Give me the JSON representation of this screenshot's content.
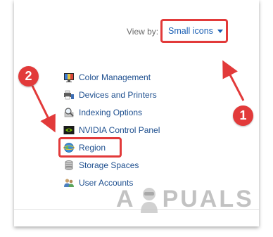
{
  "toolbar": {
    "view_by_label": "View by:",
    "view_by_value": "Small icons"
  },
  "items": [
    {
      "label": "Color Management",
      "icon": "color-management-icon"
    },
    {
      "label": "Devices and Printers",
      "icon": "devices-printers-icon"
    },
    {
      "label": "Indexing Options",
      "icon": "indexing-options-icon"
    },
    {
      "label": "NVIDIA Control Panel",
      "icon": "nvidia-icon"
    },
    {
      "label": "Region",
      "icon": "region-globe-icon"
    },
    {
      "label": "Storage Spaces",
      "icon": "storage-spaces-icon"
    },
    {
      "label": "User Accounts",
      "icon": "user-accounts-icon"
    }
  ],
  "annotations": {
    "step1": "1",
    "step2": "2",
    "highlight_color": "#e23a3a"
  },
  "watermark": {
    "text_left": "A",
    "text_right": "PUALS"
  }
}
